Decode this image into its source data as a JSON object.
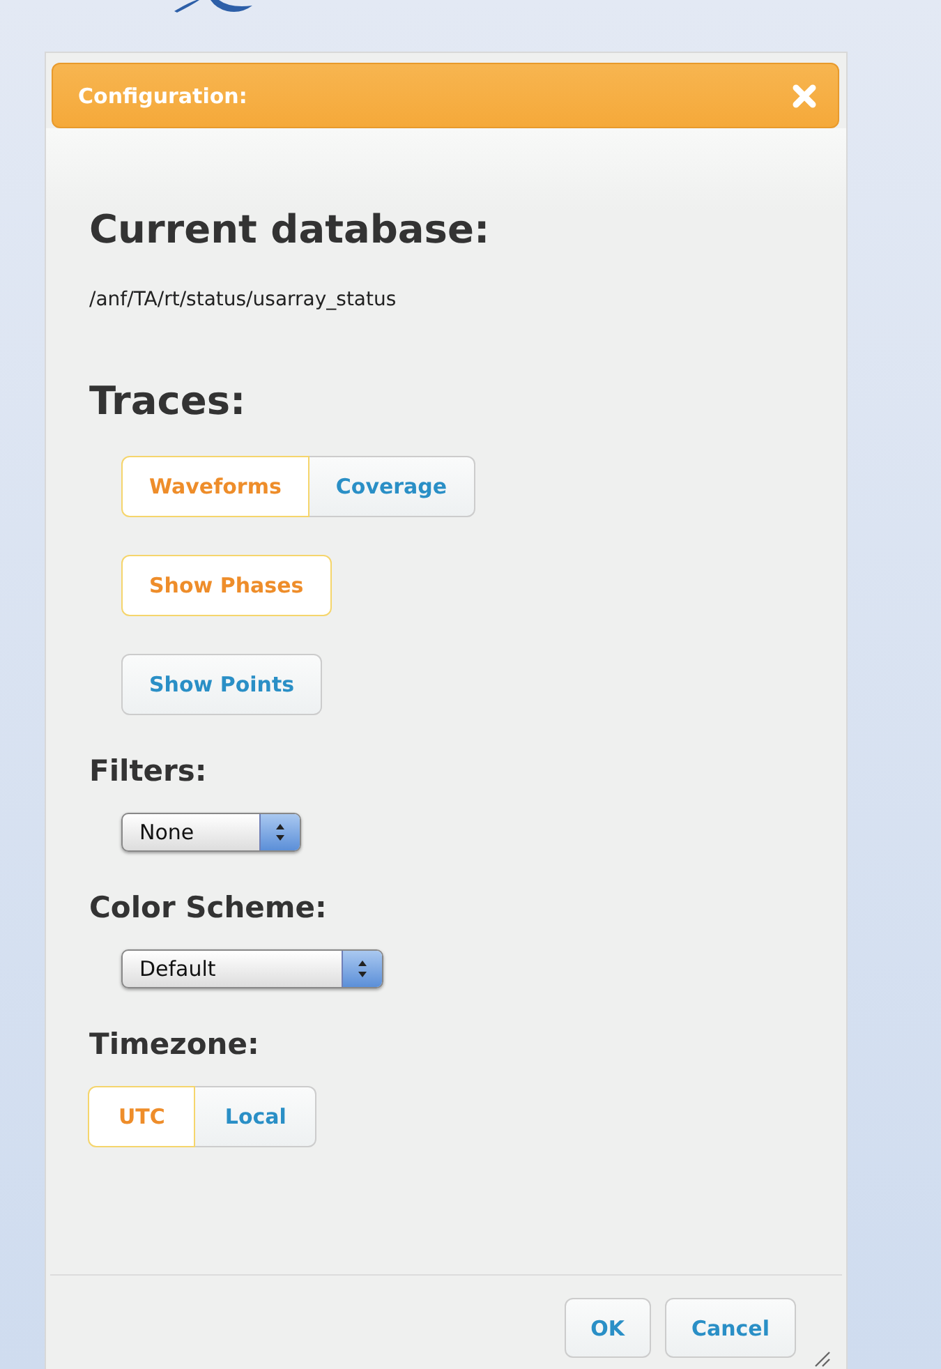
{
  "dialog": {
    "title": "Configuration:"
  },
  "database": {
    "heading": "Current database:",
    "path": "/anf/TA/rt/status/usarray_status"
  },
  "traces": {
    "heading": "Traces:",
    "mode": [
      {
        "label": "Waveforms",
        "selected": true
      },
      {
        "label": "Coverage",
        "selected": false
      }
    ],
    "toggles": [
      {
        "label": "Show Phases",
        "selected": true
      },
      {
        "label": "Show Points",
        "selected": false
      }
    ]
  },
  "filters": {
    "heading": "Filters:",
    "value": "None"
  },
  "color_scheme": {
    "heading": "Color Scheme:",
    "value": "Default"
  },
  "timezone": {
    "heading": "Timezone:",
    "options": [
      {
        "label": "UTC",
        "selected": true
      },
      {
        "label": "Local",
        "selected": false
      }
    ]
  },
  "buttons": [
    "OK",
    "Cancel"
  ]
}
